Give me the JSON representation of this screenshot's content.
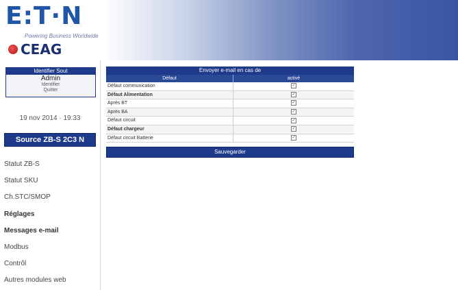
{
  "brand": {
    "logo_text": "E:T·N",
    "tagline": "Powering Business Worldwide",
    "sub_logo": "CEAG"
  },
  "user": {
    "title": "Identifier Sout",
    "name": "Admin",
    "line2": "Identifier",
    "line3": "Quitter"
  },
  "datetime": "19 nov 2014 · 19:33",
  "source_label": "Source ZB-S 2C3 N",
  "menu": [
    {
      "label": "Statut ZB-S"
    },
    {
      "label": "Statut SKU"
    },
    {
      "label": "Ch.STC/SMOP"
    },
    {
      "label": "Réglages"
    },
    {
      "label": "Messages e-mail"
    },
    {
      "label": "Modbus"
    },
    {
      "label": "Contrôl"
    },
    {
      "label": "Autres modules web"
    }
  ],
  "panel": {
    "title": "Envoyer e-mail en cas de",
    "col_default": "Défaut",
    "col_active": "activé",
    "rows": [
      {
        "label": "Défaut communication",
        "checked": true,
        "bold": false
      },
      {
        "label": "Défaut Alimentation",
        "checked": true,
        "bold": true
      },
      {
        "label": "Après BT",
        "checked": true,
        "bold": false
      },
      {
        "label": "Après BA",
        "checked": true,
        "bold": false
      },
      {
        "label": "Défaut circuit",
        "checked": true,
        "bold": false
      },
      {
        "label": "Défaut chargeur",
        "checked": true,
        "bold": true
      },
      {
        "label": "Défaut circuit Batterie",
        "checked": true,
        "bold": false
      }
    ],
    "save_label": "Sauvegarder"
  },
  "colors": {
    "accent": "#1e3a8a",
    "logo": "#1f56a8"
  }
}
